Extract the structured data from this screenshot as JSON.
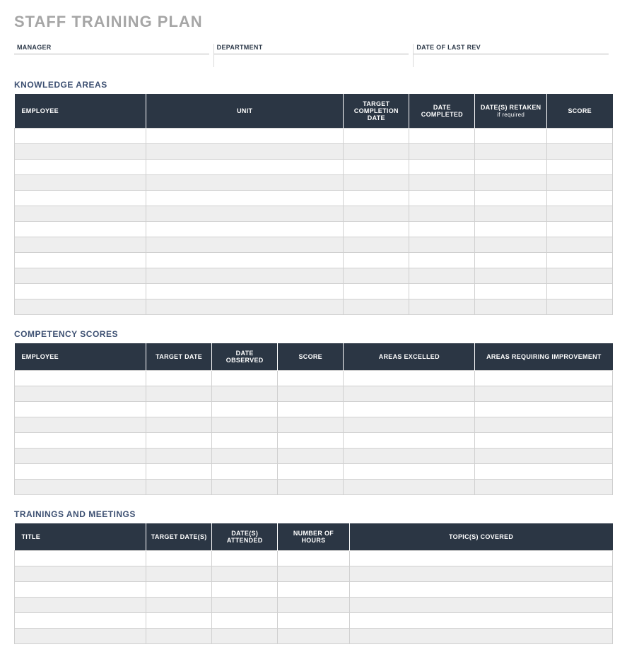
{
  "title": "STAFF TRAINING PLAN",
  "meta": {
    "manager_label": "MANAGER",
    "manager_value": "",
    "department_label": "DEPARTMENT",
    "department_value": "",
    "dolr_label": "DATE OF LAST REV",
    "dolr_value": ""
  },
  "knowledge": {
    "heading": "KNOWLEDGE AREAS",
    "headers": {
      "employee": "EMPLOYEE",
      "unit": "UNIT",
      "target": "TARGET COMPLETION DATE",
      "completed": "DATE COMPLETED",
      "retaken": "DATE(S) RETAKEN",
      "retaken_sub": "if required",
      "score": "SCORE"
    },
    "rows": [
      {
        "employee": "",
        "unit": "",
        "target": "",
        "completed": "",
        "retaken": "",
        "score": ""
      },
      {
        "employee": "",
        "unit": "",
        "target": "",
        "completed": "",
        "retaken": "",
        "score": ""
      },
      {
        "employee": "",
        "unit": "",
        "target": "",
        "completed": "",
        "retaken": "",
        "score": ""
      },
      {
        "employee": "",
        "unit": "",
        "target": "",
        "completed": "",
        "retaken": "",
        "score": ""
      },
      {
        "employee": "",
        "unit": "",
        "target": "",
        "completed": "",
        "retaken": "",
        "score": ""
      },
      {
        "employee": "",
        "unit": "",
        "target": "",
        "completed": "",
        "retaken": "",
        "score": ""
      },
      {
        "employee": "",
        "unit": "",
        "target": "",
        "completed": "",
        "retaken": "",
        "score": ""
      },
      {
        "employee": "",
        "unit": "",
        "target": "",
        "completed": "",
        "retaken": "",
        "score": ""
      },
      {
        "employee": "",
        "unit": "",
        "target": "",
        "completed": "",
        "retaken": "",
        "score": ""
      },
      {
        "employee": "",
        "unit": "",
        "target": "",
        "completed": "",
        "retaken": "",
        "score": ""
      },
      {
        "employee": "",
        "unit": "",
        "target": "",
        "completed": "",
        "retaken": "",
        "score": ""
      },
      {
        "employee": "",
        "unit": "",
        "target": "",
        "completed": "",
        "retaken": "",
        "score": ""
      }
    ]
  },
  "competency": {
    "heading": "COMPETENCY SCORES",
    "headers": {
      "employee": "EMPLOYEE",
      "target_date": "TARGET DATE",
      "date_observed": "DATE OBSERVED",
      "score": "SCORE",
      "excelled": "AREAS EXCELLED",
      "improvement": "AREAS REQUIRING IMPROVEMENT"
    },
    "rows": [
      {
        "employee": "",
        "target_date": "",
        "date_observed": "",
        "score": "",
        "excelled": "",
        "improvement": ""
      },
      {
        "employee": "",
        "target_date": "",
        "date_observed": "",
        "score": "",
        "excelled": "",
        "improvement": ""
      },
      {
        "employee": "",
        "target_date": "",
        "date_observed": "",
        "score": "",
        "excelled": "",
        "improvement": ""
      },
      {
        "employee": "",
        "target_date": "",
        "date_observed": "",
        "score": "",
        "excelled": "",
        "improvement": ""
      },
      {
        "employee": "",
        "target_date": "",
        "date_observed": "",
        "score": "",
        "excelled": "",
        "improvement": ""
      },
      {
        "employee": "",
        "target_date": "",
        "date_observed": "",
        "score": "",
        "excelled": "",
        "improvement": ""
      },
      {
        "employee": "",
        "target_date": "",
        "date_observed": "",
        "score": "",
        "excelled": "",
        "improvement": ""
      },
      {
        "employee": "",
        "target_date": "",
        "date_observed": "",
        "score": "",
        "excelled": "",
        "improvement": ""
      }
    ]
  },
  "trainings": {
    "heading": "TRAININGS AND MEETINGS",
    "headers": {
      "title": "TITLE",
      "target_dates": "TARGET DATE(S)",
      "dates_attended": "DATE(S) ATTENDED",
      "hours": "NUMBER OF HOURS",
      "topics": "TOPIC(S) COVERED"
    },
    "rows": [
      {
        "title": "",
        "target_dates": "",
        "dates_attended": "",
        "hours": "",
        "topics": ""
      },
      {
        "title": "",
        "target_dates": "",
        "dates_attended": "",
        "hours": "",
        "topics": ""
      },
      {
        "title": "",
        "target_dates": "",
        "dates_attended": "",
        "hours": "",
        "topics": ""
      },
      {
        "title": "",
        "target_dates": "",
        "dates_attended": "",
        "hours": "",
        "topics": ""
      },
      {
        "title": "",
        "target_dates": "",
        "dates_attended": "",
        "hours": "",
        "topics": ""
      },
      {
        "title": "",
        "target_dates": "",
        "dates_attended": "",
        "hours": "",
        "topics": ""
      }
    ]
  }
}
